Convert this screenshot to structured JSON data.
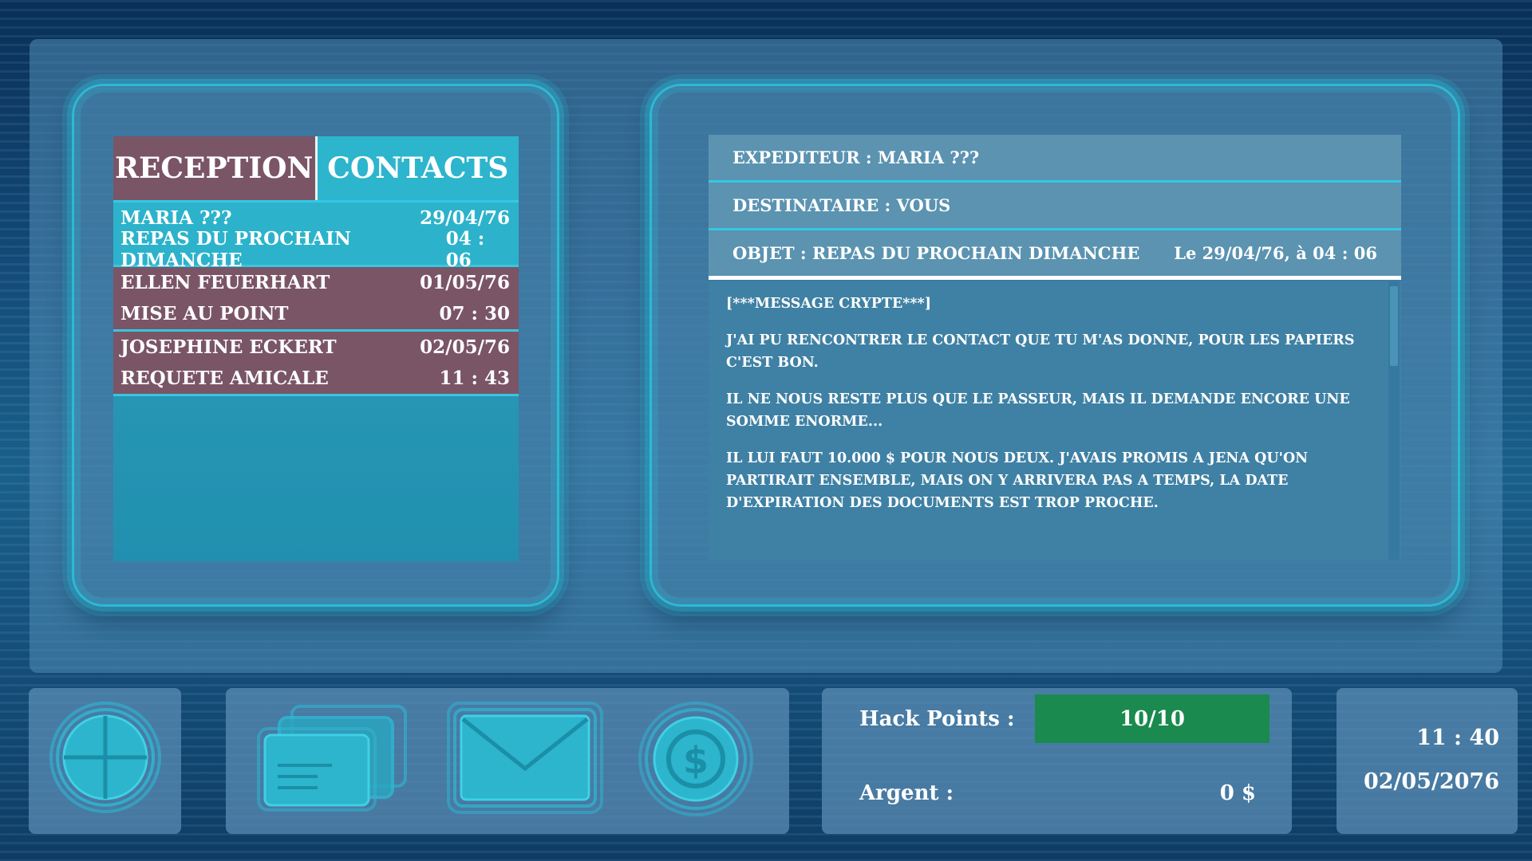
{
  "inbox": {
    "tabs": [
      {
        "label": "RECEPTION"
      },
      {
        "label": "CONTACTS"
      }
    ],
    "messages": [
      {
        "sender": "MARIA ???",
        "date": "29/04/76",
        "subject": "REPAS DU PROCHAIN DIMANCHE",
        "time": "04 : 06",
        "state": "selected"
      },
      {
        "sender": "ELLEN FEUERHART",
        "date": "01/05/76",
        "subject": "MISE AU POINT",
        "time": "07 : 30",
        "state": "unread"
      },
      {
        "sender": "JOSEPHINE ECKERT",
        "date": "02/05/76",
        "subject": "REQUETE AMICALE",
        "time": "11 : 43",
        "state": "unread"
      }
    ]
  },
  "viewer": {
    "from": "EXPEDITEUR : MARIA ???",
    "to": "DESTINATAIRE : VOUS",
    "subject": "OBJET : REPAS DU PROCHAIN DIMANCHE",
    "sent": "Le 29/04/76, à 04 : 06",
    "body": [
      "[***MESSAGE CRYPTE***]",
      "J'AI PU RENCONTRER LE CONTACT QUE TU M'AS DONNE, POUR LES PAPIERS C'EST BON.",
      "IL NE NOUS RESTE PLUS QUE LE PASSEUR, MAIS IL DEMANDE ENCORE UNE SOMME ENORME...",
      "IL LUI FAUT 10.000 $ POUR NOUS DEUX. J'AVAIS PROMIS A JENA QU'ON PARTIRAIT ENSEMBLE, MAIS ON Y ARRIVERA PAS A TEMPS, LA DATE D'EXPIRATION DES DOCUMENTS EST TROP PROCHE."
    ]
  },
  "toolbar": {
    "icons": [
      "globe-icon",
      "documents-icon",
      "mail-icon",
      "dollar-coin-icon"
    ]
  },
  "stats": {
    "hack_points_label": "Hack Points :",
    "hack_points_value": "10/10",
    "money_label": "Argent :",
    "money_value": "0 $"
  },
  "clock": {
    "time": "11 : 40",
    "date": "02/05/2076"
  },
  "colors": {
    "accent": "#2fb8d3",
    "unread": "#7a5566",
    "hack_bar": "#1a8a4e"
  }
}
